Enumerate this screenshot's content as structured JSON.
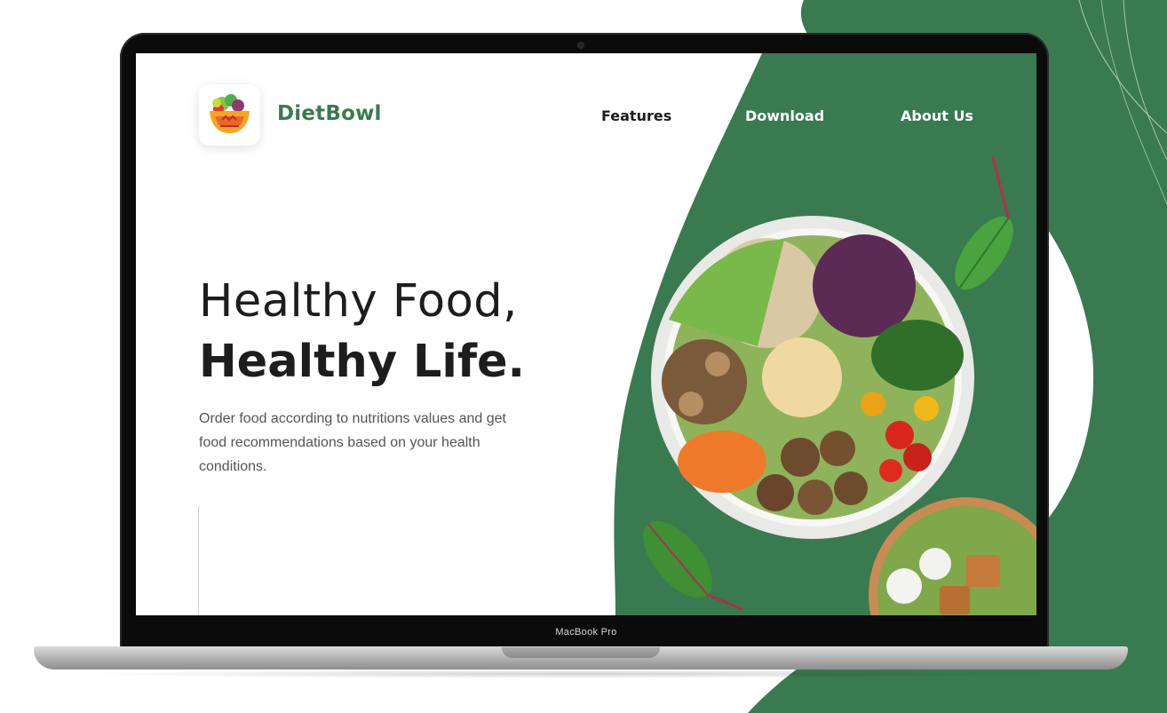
{
  "app": {
    "brand_name": "DietBowl",
    "logo_icon": "salad-bowl-icon"
  },
  "nav": {
    "items": [
      {
        "label": "Features"
      },
      {
        "label": "Download"
      },
      {
        "label": "About Us"
      }
    ]
  },
  "hero": {
    "title_line1": "Healthy Food,",
    "title_line2": "Healthy Life.",
    "description": "Order food according to nutritions values and get food recommendations based on your health conditions."
  },
  "device": {
    "model_label": "MacBook Pro"
  },
  "colors": {
    "brand_green": "#3b7a4f",
    "text_dark": "#1d1d1d",
    "text_muted": "#555555",
    "background": "#ffffff"
  }
}
